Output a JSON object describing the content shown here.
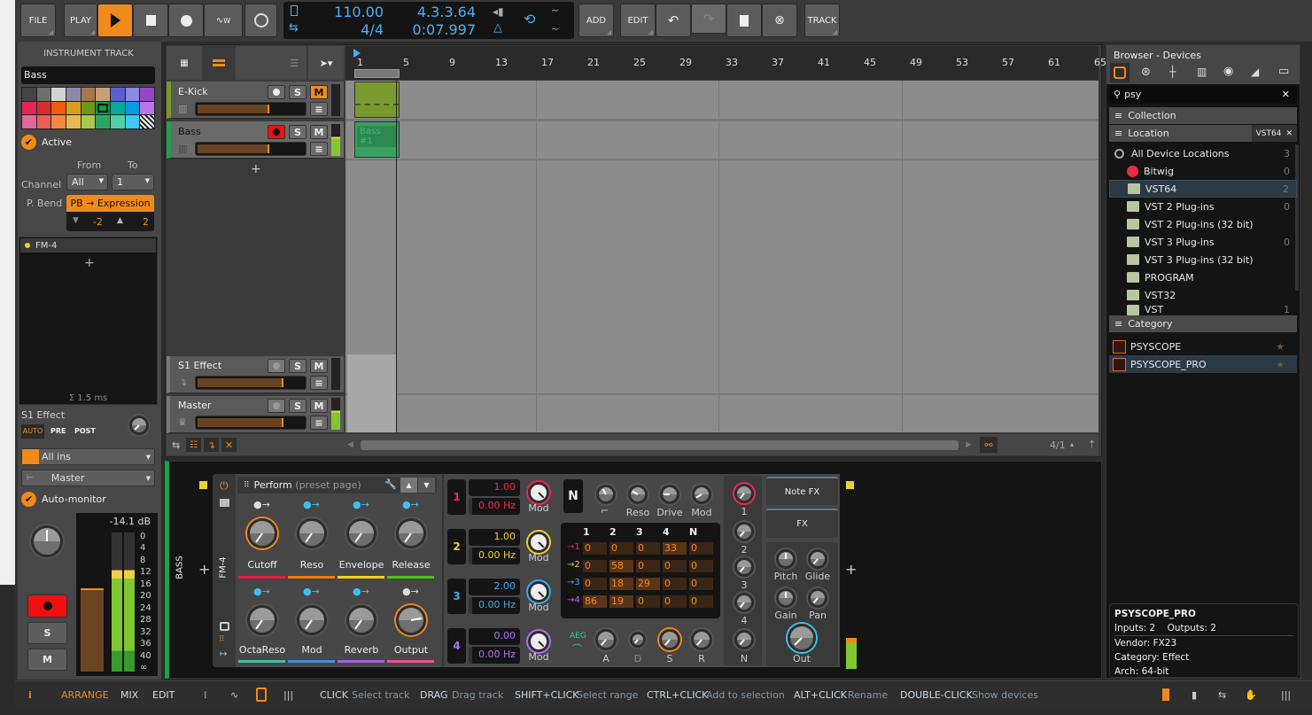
{
  "toolbar": {
    "file": "FILE",
    "play": "PLAY",
    "add": "ADD",
    "edit": "EDIT",
    "track": "TRACK",
    "tempo": "110.00",
    "time_signature": "4/4",
    "position_beats": "4.3.3.64",
    "position_time": "0:07.997",
    "automation_label": "W"
  },
  "arranger": {
    "ruler": [
      "1",
      "5",
      "9",
      "13",
      "17",
      "21",
      "25",
      "29",
      "33",
      "37",
      "41",
      "45",
      "49",
      "53",
      "57",
      "61",
      "65"
    ],
    "tracks": [
      {
        "name": "E-Kick",
        "color": "#7a9a20",
        "mute_active": true,
        "rec_armed": false
      },
      {
        "name": "Bass",
        "color": "#1ea050",
        "mute_active": false,
        "rec_armed": true
      },
      {
        "name": "S1 Effect"
      },
      {
        "name": "Master"
      }
    ],
    "clips": [
      {
        "label": ""
      },
      {
        "label": "Bass #1"
      }
    ],
    "zoom": "4/1"
  },
  "inspector": {
    "title": "INSTRUMENT TRACK",
    "track_name": "Bass",
    "active": "Active",
    "from": "From",
    "to": "To",
    "channel": "Channel",
    "channel_from": "All",
    "channel_to": "1",
    "pbend": "P. Bend",
    "pbend_mode": "PB → Expression",
    "pb_down": "-2",
    "pb_up": "2",
    "device": "FM-4",
    "latency": "Σ 1.5 ms",
    "send_name": "S1 Effect",
    "send_modes": [
      "AUTO",
      "PRE",
      "POST"
    ],
    "input": "All ins",
    "output": "Master",
    "auto_monitor": "Auto-monitor",
    "level": "-14.1 dB",
    "meter_scale": [
      "0",
      "4",
      "8",
      "12",
      "16",
      "20",
      "24",
      "28",
      "32",
      "36",
      "40",
      "∞"
    ],
    "s": "S",
    "m": "M",
    "palette": [
      "#444444",
      "#6e6e6e",
      "#d4d4d4",
      "#8a8aa8",
      "#a57850",
      "#c8a078",
      "#5a60cc",
      "#8a8ae0",
      "#9448c4",
      "#e02858",
      "#d83028",
      "#f55a10",
      "#d8a018",
      "#6e961e",
      "#00a040",
      "#08a898",
      "#0c98dc",
      "#b878e8",
      "#e06898",
      "#e86058",
      "#f58840",
      "#e8b858",
      "#a8c850",
      "#2aa860",
      "#50d0a8",
      "#40c8f8",
      "stripe"
    ]
  },
  "device": {
    "track_label": "BASS",
    "name": "FM-4",
    "page": "Perform",
    "page_hint": "(preset page)",
    "macros": [
      {
        "label": "Cutoff",
        "color": "#e02040"
      },
      {
        "label": "Reso",
        "color": "#f07a10"
      },
      {
        "label": "Envelope",
        "color": "#f0d020"
      },
      {
        "label": "Release",
        "color": "#50c020"
      },
      {
        "label": "OctaReso",
        "color": "#40c0a0"
      },
      {
        "label": "Mod",
        "color": "#4090e0"
      },
      {
        "label": "Reverb",
        "color": "#a060e0"
      },
      {
        "label": "Output",
        "color": "#f05090"
      }
    ],
    "operators": [
      {
        "n": "1",
        "ratio": "1.00",
        "freq": "0.00 Hz",
        "color": "#f02850"
      },
      {
        "n": "2",
        "ratio": "1.00",
        "freq": "0.00 Hz",
        "color": "#f0d030"
      },
      {
        "n": "3",
        "ratio": "2.00",
        "freq": "0.00 Hz",
        "color": "#40a8f0"
      },
      {
        "n": "4",
        "ratio": "0.00",
        "freq": "0.00 Hz",
        "color": "#b070f0"
      }
    ],
    "mod_label": "Mod",
    "n_label": "N",
    "filter_knobs": [
      "",
      "Reso",
      "Drive",
      "Mod"
    ],
    "matrix_cols": [
      "1",
      "2",
      "3",
      "4",
      "N"
    ],
    "matrix_rows": [
      {
        "label": "→1",
        "values": [
          "0",
          "0",
          "0",
          "33",
          "0"
        ]
      },
      {
        "label": "→2",
        "values": [
          "0",
          "58",
          "0",
          "0",
          "0"
        ]
      },
      {
        "label": "→3",
        "values": [
          "0",
          "18",
          "29",
          "0",
          "0"
        ]
      },
      {
        "label": "→4",
        "values": [
          "86",
          "19",
          "0",
          "0",
          "0"
        ]
      }
    ],
    "aeg": "AEG",
    "env_knobs": [
      "A",
      "D",
      "S",
      "R"
    ],
    "level_knobs": [
      "1",
      "2",
      "3",
      "4",
      "N"
    ],
    "note_fx": "Note FX",
    "fx": "FX",
    "out_knobs": [
      "Pitch",
      "Glide",
      "Gain",
      "Pan"
    ],
    "out": "Out"
  },
  "browser": {
    "title": "Browser - Devices",
    "search": "psy",
    "collection": "Collection",
    "location": "Location",
    "location_filter": "VST64",
    "locations": [
      {
        "name": "All Device Locations",
        "count": "3"
      },
      {
        "name": "Bitwig",
        "count": "0"
      },
      {
        "name": "VST64",
        "count": "2",
        "selected": true
      },
      {
        "name": "VST 2 Plug-ins",
        "count": "0"
      },
      {
        "name": "VST 2 Plug-ins (32 bit)",
        "count": ""
      },
      {
        "name": "VST 3 Plug-ins",
        "count": "0"
      },
      {
        "name": "VST 3 Plug-ins (32 bit)",
        "count": ""
      },
      {
        "name": "PROGRAM",
        "count": ""
      },
      {
        "name": "VST32",
        "count": ""
      },
      {
        "name": "VST",
        "count": "1"
      }
    ],
    "category": "Category",
    "results": [
      {
        "name": "PSYSCOPE"
      },
      {
        "name": "PSYSCOPE_PRO",
        "selected": true
      }
    ],
    "info": {
      "name": "PSYSCOPE_PRO",
      "io": "Inputs: 2    Outputs: 2",
      "vendor": "Vendor: FX23",
      "category": "Category: Effect",
      "arch": "Arch: 64-bit"
    }
  },
  "statusbar": {
    "arrange": "ARRANGE",
    "mix": "MIX",
    "edit": "EDIT",
    "hints": [
      {
        "key": "CLICK",
        "action": "Select track"
      },
      {
        "key": "DRAG",
        "action": "Drag track"
      },
      {
        "key": "SHIFT+CLICK",
        "action": "Select range"
      },
      {
        "key": "CTRL+CLICK",
        "action": "Add to selection"
      },
      {
        "key": "ALT+CLICK",
        "action": "Rename"
      },
      {
        "key": "DOUBLE-CLICK",
        "action": "Show devices"
      }
    ]
  },
  "colors": {
    "accent": "#f08a1a",
    "display_text": "#4ab0f0",
    "record": "#f01010"
  }
}
